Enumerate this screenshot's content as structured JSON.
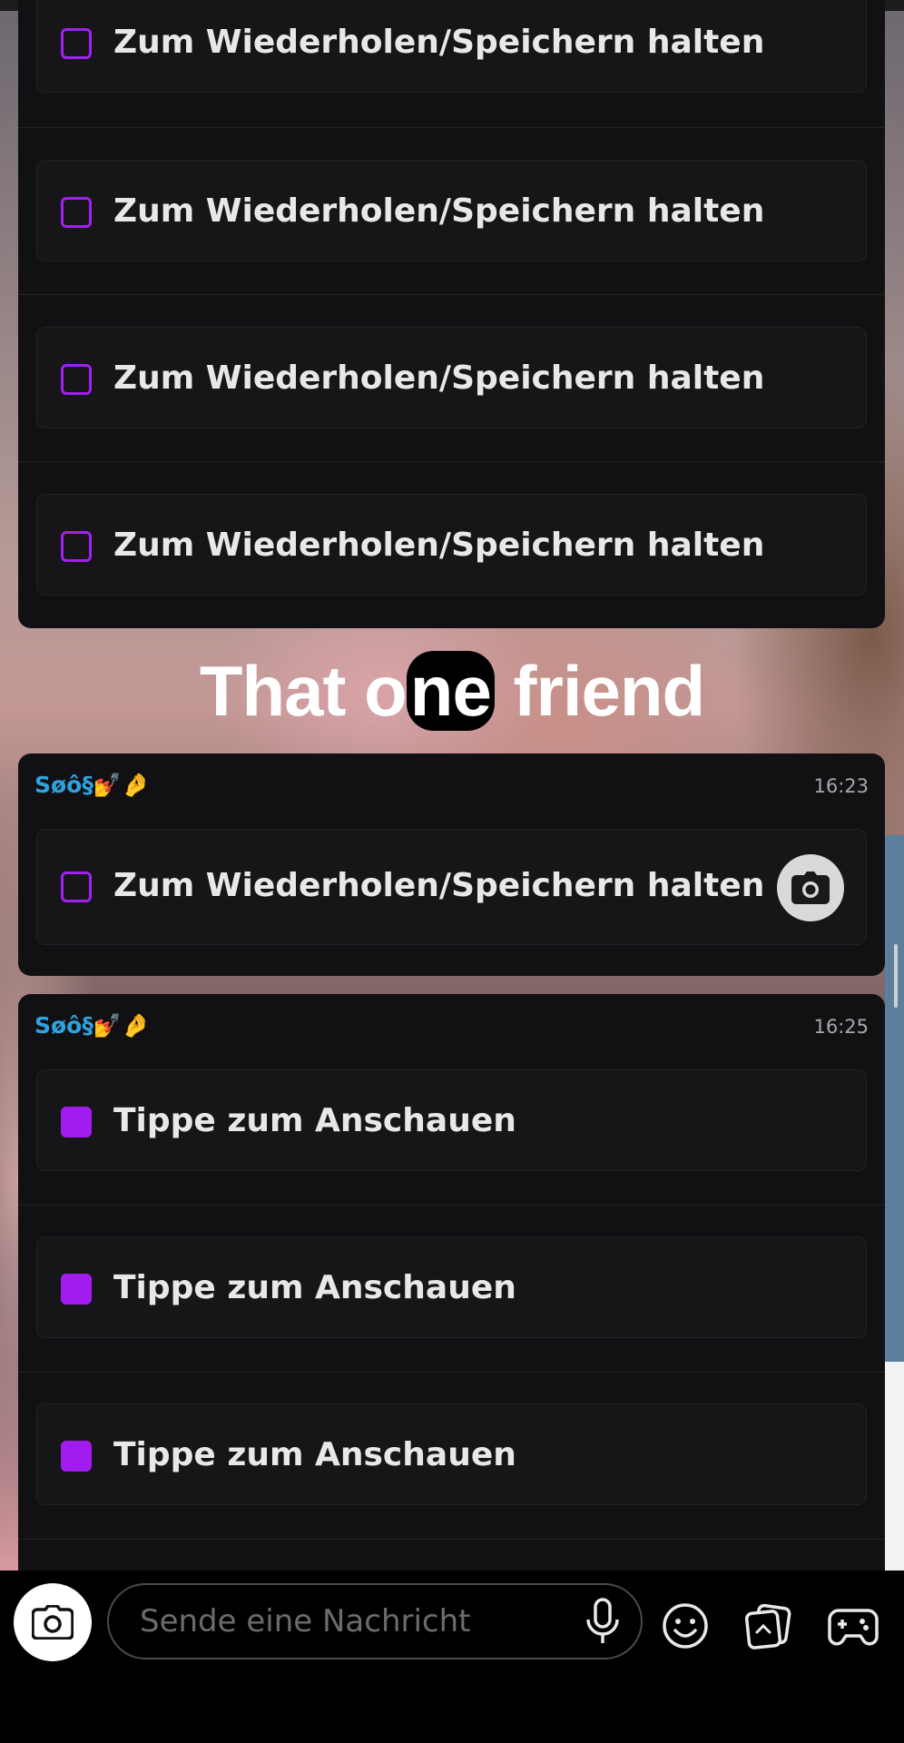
{
  "caption": {
    "before": "That o",
    "highlight": "ne",
    "after": " friend"
  },
  "card1": {
    "rows": [
      {
        "label": "Zum Wiederholen/Speichern halten"
      },
      {
        "label": "Zum Wiederholen/Speichern halten"
      },
      {
        "label": "Zum Wiederholen/Speichern halten"
      },
      {
        "label": "Zum Wiederholen/Speichern halten"
      }
    ]
  },
  "card2": {
    "sender": "Søô§💅🤌",
    "time": "16:23",
    "rows": [
      {
        "label": "Zum Wiederholen/Speichern halten"
      }
    ]
  },
  "card3": {
    "sender": "Søô§💅🤌",
    "time": "16:25",
    "rows": [
      {
        "label": "Tippe zum Anschauen"
      },
      {
        "label": "Tippe zum Anschauen"
      },
      {
        "label": "Tippe zum Anschauen"
      }
    ]
  },
  "composer": {
    "placeholder": "Sende eine Nachricht"
  },
  "colors": {
    "accent_purple": "#a21cf0",
    "sender_blue": "#2ea3e0",
    "card_bg": "#111113"
  },
  "icons": [
    "camera-icon",
    "microphone-icon",
    "emoji-icon",
    "stickers-icon",
    "games-icon"
  ]
}
